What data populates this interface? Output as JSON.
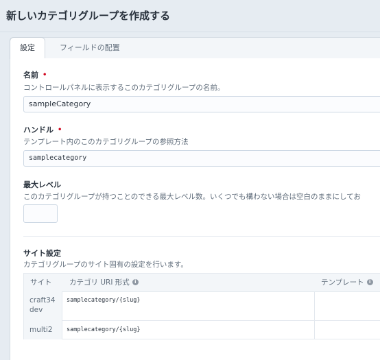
{
  "page": {
    "title": "新しいカテゴリグループを作成する"
  },
  "tabs": [
    {
      "label": "設定",
      "active": true
    },
    {
      "label": "フィールドの配置",
      "active": false
    }
  ],
  "fields": {
    "name": {
      "label": "名前",
      "required_mark": "•",
      "help": "コントロールパネルに表示するこのカテゴリグループの名前。",
      "value": "sampleCategory"
    },
    "handle": {
      "label": "ハンドル",
      "required_mark": "•",
      "help": "テンプレート内のこのカテゴリグループの参照方法",
      "value": "samplecategory"
    },
    "max_levels": {
      "label": "最大レベル",
      "help": "このカテゴリグループが持つことのできる最大レベル数。いくつでも構わない場合は空白のままにしてお",
      "value": ""
    }
  },
  "site_settings": {
    "label": "サイト設定",
    "help": "カテゴリグループのサイト固有の設定を行います。",
    "columns": [
      "サイト",
      "カテゴリ URI 形式",
      "テンプレート"
    ],
    "info_glyph": "i",
    "rows": [
      {
        "site_line1": "craft34",
        "site_line2": "dev",
        "uri_format": "samplecategory/{slug}",
        "template": ""
      },
      {
        "site_line1": "multi2",
        "site_line2": "",
        "uri_format": "samplecategory/{slug}",
        "template": ""
      }
    ]
  },
  "colors": {
    "background": "#e6ecf2",
    "panel": "#ffffff",
    "required": "#d0021b",
    "text": "#29323d",
    "muted": "#606d7b"
  }
}
